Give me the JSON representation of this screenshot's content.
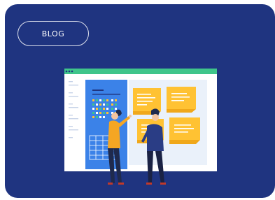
{
  "card": {
    "background": "#1f3480",
    "pill_label": "BLOG"
  },
  "illustration": {
    "browser_bar_color": "#3fc58a",
    "panel_color": "#3b82e8",
    "sticky_note_color": "#ffc233",
    "person_left_shirt": "#f5a623",
    "person_right_shirt": "#2a3d85"
  }
}
